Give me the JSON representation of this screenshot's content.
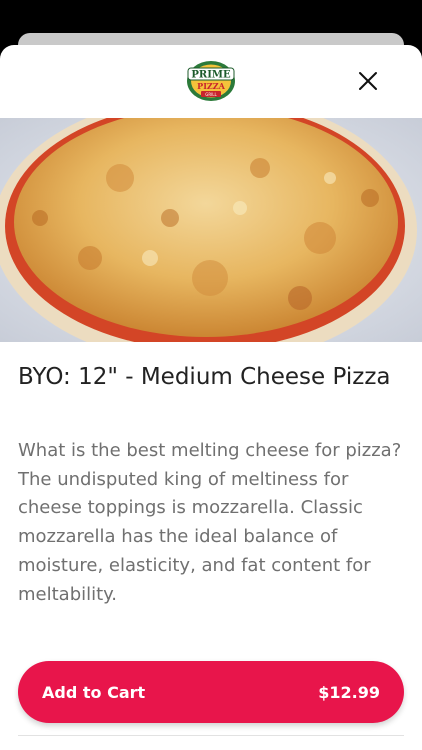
{
  "logo": {
    "line1": "PRIME",
    "line2": "PIZZA",
    "line3": "GRILL"
  },
  "icons": {
    "close": "close-icon"
  },
  "colors": {
    "accent": "#e8154b",
    "logo_green": "#2c7a3a",
    "logo_red": "#c8242c"
  },
  "product": {
    "title": "BYO: 12\" - Medium Cheese Pizza",
    "description": "What is the best melting cheese for pizza? The undisputed king of meltiness for cheese toppings is mozzarella. Classic mozzarella has the ideal balance of moisture, elasticity, and fat content for meltability."
  },
  "cart_button": {
    "label": "Add to Cart",
    "price": "$12.99"
  }
}
